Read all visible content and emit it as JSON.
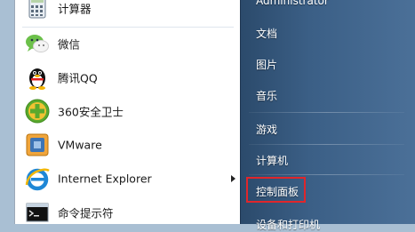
{
  "programs": [
    {
      "label": "计算器",
      "icon": "calculator-icon"
    },
    {
      "label": "微信",
      "icon": "wechat-icon"
    },
    {
      "label": "腾讯QQ",
      "icon": "qq-penguin-icon"
    },
    {
      "label": "360安全卫士",
      "icon": "shield-360-icon"
    },
    {
      "label": "VMware",
      "icon": "vmware-icon"
    },
    {
      "label": "Internet Explorer",
      "icon": "internet-explorer-icon"
    },
    {
      "label": "命令提示符",
      "icon": "command-prompt-icon"
    }
  ],
  "right_pane": {
    "user": "Administrator",
    "documents": "文档",
    "pictures": "图片",
    "music": "音乐",
    "games": "游戏",
    "computer": "计算机",
    "control_panel": "控制面板",
    "devices_printers": "设备和打印机"
  },
  "colors": {
    "highlight_border": "#e0262b",
    "right_pane_bg": "#3b5f86"
  }
}
